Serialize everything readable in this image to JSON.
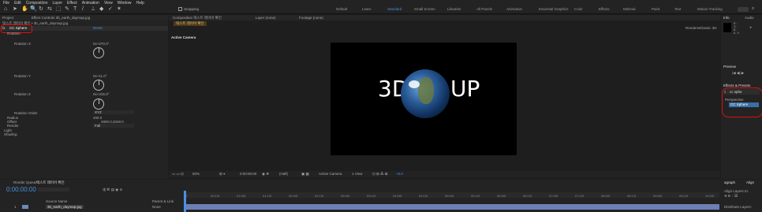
{
  "menu": [
    "File",
    "Edit",
    "Composition",
    "Layer",
    "Effect",
    "Animation",
    "View",
    "Window",
    "Help"
  ],
  "toolbar": {
    "tools": [
      "⌂",
      "➤",
      "✋",
      "🔍",
      "↻",
      "⇆",
      "⬚",
      "✎",
      "T",
      "/",
      "⊥",
      "◆",
      "✓",
      "✶"
    ],
    "snapping_label": "Snapping",
    "workspaces": [
      "Default",
      "Learn",
      "Standard",
      "Small Screen",
      "Libraries",
      "All Panels",
      "Animation",
      "Essential Graphics",
      "Color",
      "Effects",
      "Minimal",
      "Paint",
      "Text",
      "Motion Tracking"
    ],
    "active_workspace": "Standard"
  },
  "project_tab": "Project",
  "effect_controls": {
    "tab": "Effect Controls 3b_earth_daymap.jpg",
    "layer_path": "텍스트 레이어 확인 • 3b_earth_daymap.jpg",
    "effect_name": "CC Sphere",
    "reset_label": "Reset",
    "rows": [
      {
        "label": "Rotation",
        "value": ""
      },
      {
        "label": "Rotation X",
        "value": "0x+270.0°"
      },
      {
        "label": "Rotation Y",
        "value": "0x+11.0°"
      },
      {
        "label": "Rotation Z",
        "value": "0x+315.0°"
      },
      {
        "label": "Rotation Order",
        "value": "XYZ"
      },
      {
        "label": "Radius",
        "value": "200.0"
      },
      {
        "label": "Offset",
        "value": "4800.0,2048.0"
      },
      {
        "label": "Render",
        "value": "Full"
      },
      {
        "label": "Light",
        "value": ""
      },
      {
        "label": "Shading",
        "value": ""
      }
    ]
  },
  "composition": {
    "tab": "Composition 텍스트 레이어 확인",
    "sub_tab": "텍스트 레이어 확인",
    "layer_tab": "Layer (none)",
    "footage_tab": "Footage (none)",
    "active_camera": "Active Camera",
    "renderer": "Renderer:",
    "renderer_value": "Classic 3D",
    "canvas_text_left": "3D",
    "canvas_text_right": "UP",
    "footer": {
      "zoom": "50%",
      "time": "0:00:00:00",
      "resolution": "(Half)",
      "camera": "Active Camera",
      "view": "1 View",
      "exposure": "+0.0"
    }
  },
  "right_panels": {
    "info_tab": "Info",
    "audio_tab": "Audio",
    "info_rows": [
      "R :",
      "G :",
      "B :",
      "A : 0"
    ],
    "info_coords": [
      "X :",
      "Y :"
    ],
    "preview_tab": "Preview",
    "effects_tab": "Effects & Presets",
    "search_value": "cc sphe",
    "category": "Perspective",
    "result": "CC Sphere",
    "align_tab": "Align",
    "paragraph_tab": "agraph",
    "align_layers_to": "Align Layers to:",
    "distribute": "Distribute Layers:"
  },
  "timeline": {
    "render_queue": "Render Queue",
    "tab": "텍스트 레이어 확인",
    "timecode": "0:00:00:00",
    "columns": [
      "Source Name",
      "Parent & Link"
    ],
    "layer_number": "1",
    "layer_name": "3b_earth_daymap.jpg",
    "parent": "None",
    "ticks": [
      "0f",
      "00:12f",
      "01:00f",
      "01:12f",
      "02:00f",
      "02:12f",
      "03:00f",
      "03:12f",
      "04:00f",
      "04:12f",
      "05:00f",
      "05:12f",
      "06:00f",
      "06:12f",
      "07:00f",
      "07:12f",
      "08:00f",
      "08:12f",
      "09:00f",
      "09:12f",
      "10:00f"
    ]
  },
  "colors": {
    "accent": "#4a90e2",
    "highlight": "#e01010",
    "panel": "#232323",
    "bg": "#1d1d1d"
  }
}
